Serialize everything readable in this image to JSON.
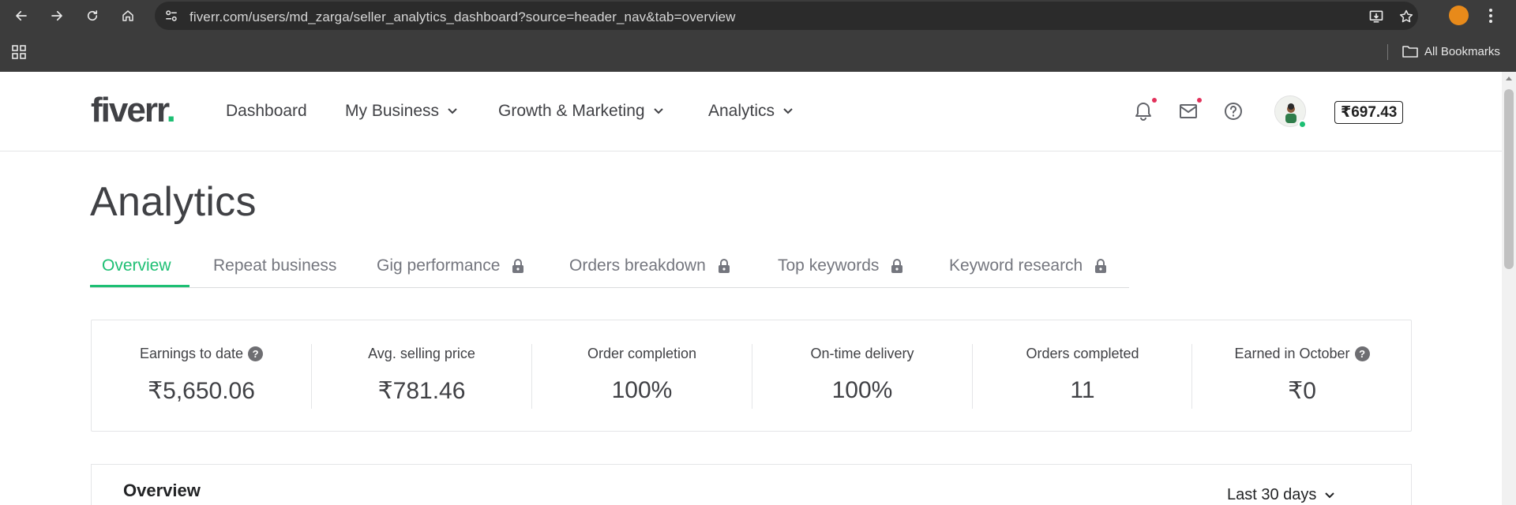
{
  "browser": {
    "url": "fiverr.com/users/md_zarga/seller_analytics_dashboard?source=header_nav&tab=overview",
    "all_bookmarks_label": "All Bookmarks"
  },
  "header": {
    "logo": "fiverr",
    "logo_dot": ".",
    "nav": {
      "dashboard": "Dashboard",
      "my_business": "My Business",
      "growth_marketing": "Growth & Marketing",
      "analytics": "Analytics"
    },
    "balance": "₹697.43"
  },
  "page": {
    "title": "Analytics",
    "tabs": [
      {
        "label": "Overview",
        "locked": false,
        "active": true
      },
      {
        "label": "Repeat business",
        "locked": false,
        "active": false
      },
      {
        "label": "Gig performance",
        "locked": true,
        "active": false
      },
      {
        "label": "Orders breakdown",
        "locked": true,
        "active": false
      },
      {
        "label": "Top keywords",
        "locked": true,
        "active": false
      },
      {
        "label": "Keyword research",
        "locked": true,
        "active": false
      }
    ],
    "stats": [
      {
        "label": "Earnings to date",
        "value": "₹5,650.06",
        "help": true
      },
      {
        "label": "Avg. selling price",
        "value": "₹781.46",
        "help": false
      },
      {
        "label": "Order completion",
        "value": "100%",
        "help": false
      },
      {
        "label": "On-time delivery",
        "value": "100%",
        "help": false
      },
      {
        "label": "Orders completed",
        "value": "11",
        "help": false
      },
      {
        "label": "Earned in October",
        "value": "₹0",
        "help": true
      }
    ],
    "overview": {
      "title": "Overview",
      "range": "Last 30 days"
    }
  },
  "colors": {
    "brand_green": "#1dbf73",
    "text_dark": "#404145",
    "text_muted": "#74767e",
    "notification_dot": "#e2315b"
  }
}
